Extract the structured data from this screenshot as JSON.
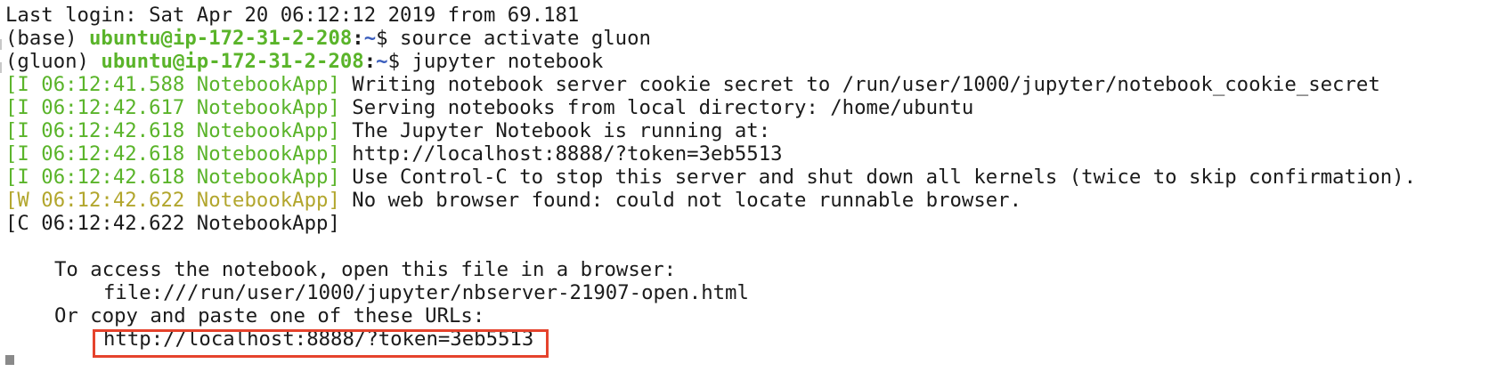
{
  "terminal": {
    "last_login": "Last login: Sat Apr 20 06:12:12 2019 from 69.181",
    "prompt1": {
      "env": "(base) ",
      "user_host": "ubuntu@ip-172-31-2-208",
      "colon": ":",
      "path": "~",
      "dollar": "$ ",
      "command": "source activate gluon"
    },
    "prompt2": {
      "env": "(gluon) ",
      "user_host": "ubuntu@ip-172-31-2-208",
      "colon": ":",
      "path": "~",
      "dollar": "$ ",
      "command": "jupyter notebook"
    },
    "logs": [
      {
        "tag": "[I 06:12:41.588 NotebookApp]",
        "message": " Writing notebook server cookie secret to /run/user/1000/jupyter/notebook_cookie_secret"
      },
      {
        "tag": "[I 06:12:42.617 NotebookApp]",
        "message": " Serving notebooks from local directory: /home/ubuntu"
      },
      {
        "tag": "[I 06:12:42.618 NotebookApp]",
        "message": " The Jupyter Notebook is running at:"
      },
      {
        "tag": "[I 06:12:42.618 NotebookApp]",
        "message": " http://localhost:8888/?token=3eb5513"
      },
      {
        "tag": "[I 06:12:42.618 NotebookApp]",
        "message": " Use Control-C to stop this server and shut down all kernels (twice to skip confirmation)."
      },
      {
        "tag": "[W 06:12:42.622 NotebookApp]",
        "message": " No web browser found: could not locate runnable browser."
      },
      {
        "tag": "[C 06:12:42.622 NotebookApp]",
        "message": ""
      }
    ],
    "access_note": "To access the notebook, open this file in a browser:",
    "file_url": "file:///run/user/1000/jupyter/nbserver-21907-open.html",
    "copy_note": "Or copy and paste one of these URLs:",
    "token_url": "http://localhost:8888/?token=3eb5513"
  },
  "colors": {
    "green": "#5ab42a",
    "blue": "#3a5dbd",
    "olive": "#b2a62d",
    "highlight_border": "#e5432d",
    "text": "#1b1b1b"
  }
}
